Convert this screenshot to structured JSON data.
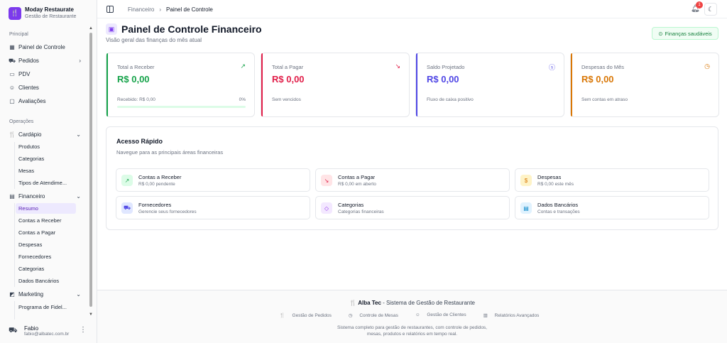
{
  "brand": {
    "name": "Moday Restaurate",
    "subtitle": "Gestão de Restaurante",
    "logo_icon": "utensils-icon"
  },
  "sidebar": {
    "groups": {
      "principal": "Principal",
      "operacoes": "Operações"
    },
    "items": [
      {
        "label": "Painel de Controle",
        "icon": "grid-icon"
      },
      {
        "label": "Pedidos",
        "icon": "cart-icon"
      },
      {
        "label": "PDV",
        "icon": "pos-icon"
      },
      {
        "label": "Clientes",
        "icon": "users-icon"
      },
      {
        "label": "Avaliações",
        "icon": "message-icon"
      },
      {
        "label": "Cardápio",
        "icon": "utensils-icon"
      },
      {
        "label": "Financeiro",
        "icon": "wallet-icon"
      },
      {
        "label": "Marketing",
        "icon": "megaphone-icon"
      }
    ],
    "cardapio_sub": [
      "Produtos",
      "Categorias",
      "Mesas",
      "Tipos de Atendime..."
    ],
    "financeiro_sub": [
      "Resumo",
      "Contas a Receber",
      "Contas a Pagar",
      "Despesas",
      "Fornecedores",
      "Categorias",
      "Dados Bancários"
    ],
    "marketing_sub": [
      "Programa de Fidel..."
    ],
    "active_item": "Resumo"
  },
  "user": {
    "name": "Fabio",
    "email": "fabio@albatec.com.br"
  },
  "topbar": {
    "breadcrumb": [
      "Financeiro",
      "Painel de Controle"
    ],
    "notification_count": "1"
  },
  "header": {
    "title": "Painel de Controle Financeiro",
    "subtitle": "Visão geral das finanças do mês atual",
    "badge": "Finanças saudáveis"
  },
  "cards": [
    {
      "label": "Total a Receber",
      "value": "R$ 0,00",
      "note": "Recebido: R$ 0,00",
      "percent": "0%",
      "progress": 0,
      "color": "#16a34a",
      "icon": "trending-up-icon"
    },
    {
      "label": "Total a Pagar",
      "value": "R$ 0,00",
      "note": "Sem vencidos",
      "color": "#e11d48",
      "icon": "trending-down-icon"
    },
    {
      "label": "Saldo Projetado",
      "value": "R$ 0,00",
      "note": "Fluxo de caixa positivo",
      "color": "#4f46e5",
      "icon": "dollar-circle-icon"
    },
    {
      "label": "Despesas do Mês",
      "value": "R$ 0,00",
      "note": "Sem contas em atraso",
      "color": "#d97706",
      "icon": "clock-icon"
    }
  ],
  "quick_access": {
    "title": "Acesso Rápido",
    "subtitle": "Navegue para as principais áreas financeiras",
    "items": [
      {
        "title": "Contas a Receber",
        "sub": "R$ 0,00 pendente",
        "icon": "trending-up-icon",
        "color": "#16a34a",
        "bg": "#dcfce7"
      },
      {
        "title": "Contas a Pagar",
        "sub": "R$ 0,00 em aberto",
        "icon": "trending-down-icon",
        "color": "#e11d48",
        "bg": "#ffe4e6"
      },
      {
        "title": "Despesas",
        "sub": "R$ 0,00 este mês",
        "icon": "dollar-icon",
        "color": "#d97706",
        "bg": "#fef3c7"
      },
      {
        "title": "Fornecedores",
        "sub": "Gerencie seus fornecedores",
        "icon": "truck-icon",
        "color": "#4f46e5",
        "bg": "#e0e7ff"
      },
      {
        "title": "Categorias",
        "sub": "Categorias financeiras",
        "icon": "tag-icon",
        "color": "#9333ea",
        "bg": "#f3e8ff"
      },
      {
        "title": "Dados Bancários",
        "sub": "Contas e transações",
        "icon": "document-icon",
        "color": "#0284c7",
        "bg": "#e0f2fe"
      }
    ]
  },
  "footer": {
    "brand": "Alba Tec",
    "tagline": " - Sistema de Gestão de Restaurante",
    "links": [
      "Gestão de Pedidos",
      "Controle de Mesas",
      "Gestão de Clientes",
      "Relatórios Avançados"
    ],
    "desc_line1": "Sistema completo para gestão de restaurantes, com controle de pedidos,",
    "desc_line2": "mesas, produtos e relatórios em tempo real."
  }
}
